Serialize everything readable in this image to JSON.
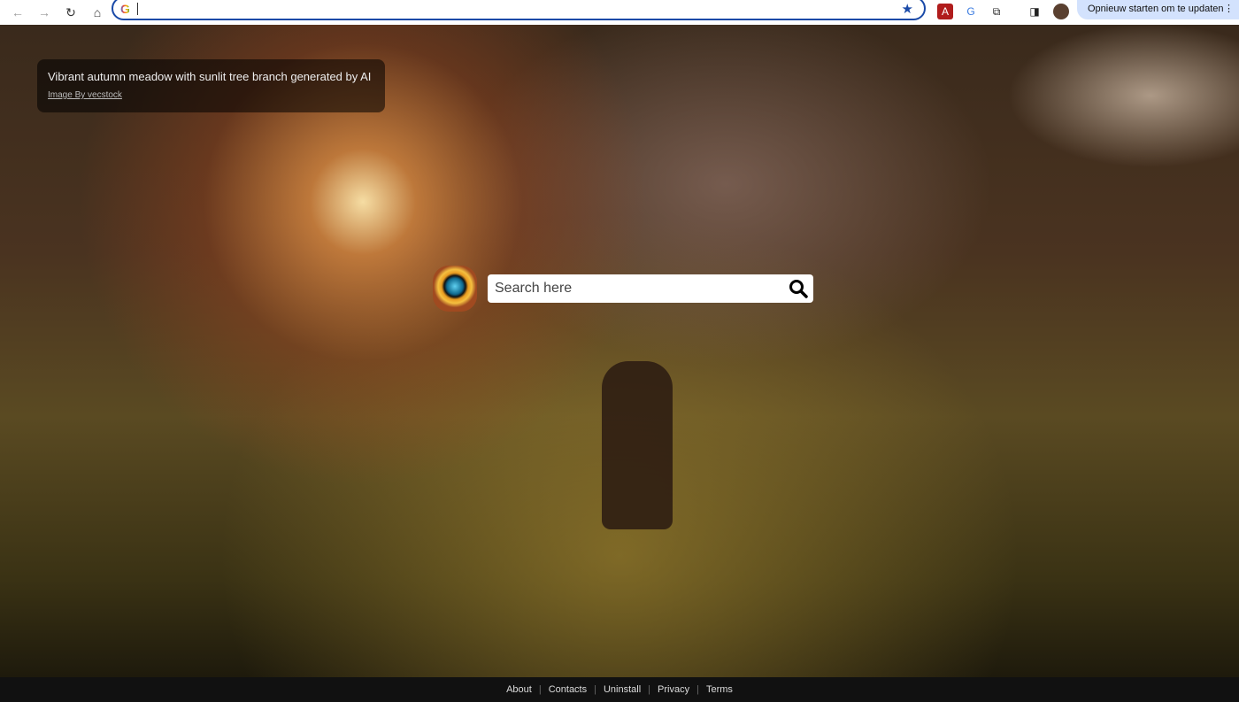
{
  "browser": {
    "update_label": "Opnieuw starten om te updaten",
    "address_value": ""
  },
  "caption": {
    "title": "Vibrant autumn meadow with sunlit tree branch generated by AI",
    "credit": "Image By vecstock"
  },
  "search": {
    "placeholder": "Search here"
  },
  "footer": {
    "links": [
      "About",
      "Contacts",
      "Uninstall",
      "Privacy",
      "Terms"
    ]
  },
  "colors": {
    "omnibox_border": "#1a4aa8",
    "update_bg": "#d3e2fd"
  }
}
